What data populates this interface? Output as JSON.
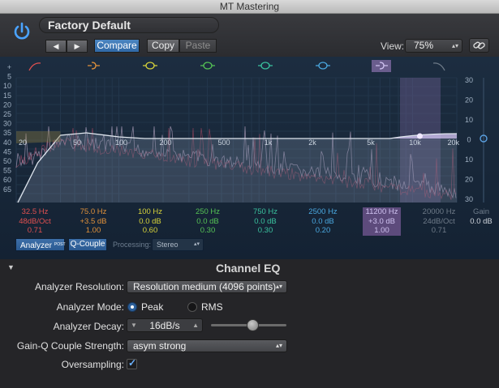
{
  "window": {
    "title": "MT Mastering"
  },
  "header": {
    "preset": "Factory Default",
    "prev_label": "◀",
    "next_label": "▶",
    "compare": "Compare",
    "copy": "Copy",
    "paste": "Paste",
    "view_label": "View:",
    "view_value": "75%"
  },
  "eq": {
    "db_scale_left": [
      "+",
      "5",
      "10",
      "15",
      "20",
      "25",
      "30",
      "35",
      "40",
      "45",
      "50",
      "55",
      "60",
      "65"
    ],
    "db_scale_right": [
      "30",
      "20",
      "10",
      "0",
      "10",
      "20",
      "30"
    ],
    "freq_axis": [
      "20",
      "50",
      "100",
      "200",
      "500",
      "1k",
      "2k",
      "5k",
      "10k",
      "20k"
    ],
    "bands": [
      {
        "freq": "32.5 Hz",
        "gain": "48dB/Oct",
        "q": "0.71",
        "color": "#e05050"
      },
      {
        "freq": "75.0 Hz",
        "gain": "+3.5 dB",
        "q": "1.00",
        "color": "#e0913a"
      },
      {
        "freq": "100 Hz",
        "gain": "0.0 dB",
        "q": "0.60",
        "color": "#d6d23a"
      },
      {
        "freq": "250 Hz",
        "gain": "0.0 dB",
        "q": "0.30",
        "color": "#55c255"
      },
      {
        "freq": "750 Hz",
        "gain": "0.0 dB",
        "q": "0.30",
        "color": "#3ac29e"
      },
      {
        "freq": "2500 Hz",
        "gain": "0.0 dB",
        "q": "0.20",
        "color": "#4aa8e0"
      },
      {
        "freq": "11200 Hz",
        "gain": "+3.0 dB",
        "q": "1.00",
        "color": "#cfc2f0"
      },
      {
        "freq": "20000 Hz",
        "gain": "24dB/Oct",
        "q": "0.71",
        "color": "#6e7a88"
      }
    ],
    "gain": {
      "label": "Gain",
      "value": "0.0 dB"
    },
    "analyzer_label": "Analyzer",
    "analyzer_post": "POST",
    "qcouple_label": "Q-Couple",
    "processing_label": "Processing:",
    "processing_value": "Stereo"
  },
  "channel_eq": {
    "title": "Channel EQ",
    "analyzer_resolution_label": "Analyzer Resolution:",
    "analyzer_resolution_value": "Resolution medium (4096 points)",
    "analyzer_mode_label": "Analyzer Mode:",
    "mode_peak": "Peak",
    "mode_rms": "RMS",
    "analyzer_decay_label": "Analyzer Decay:",
    "analyzer_decay_value": "16dB/s",
    "analyzer_decay_level": 0.55,
    "gainq_label": "Gain-Q Couple Strength:",
    "gainq_value": "asym strong",
    "oversampling_label": "Oversampling:",
    "oversampling_checked": true
  }
}
